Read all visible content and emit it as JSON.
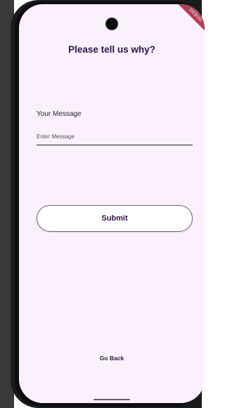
{
  "debug_banner": "DEBUG",
  "header": {
    "title": "Please tell us why?"
  },
  "form": {
    "message_label": "Your Message",
    "message_placeholder": "Enter Message",
    "message_value": "",
    "submit_label": "Submit"
  },
  "footer": {
    "go_back_label": "Go Back"
  },
  "colors": {
    "screen_background": "#fbf1fd",
    "title_text": "#2a1445",
    "debug_ribbon": "#b0415a"
  }
}
